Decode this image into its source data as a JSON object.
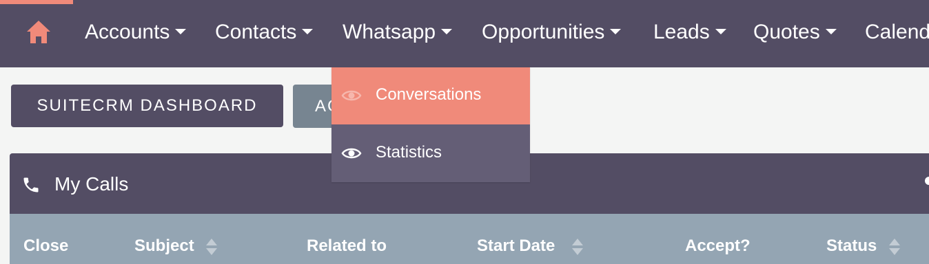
{
  "nav": {
    "items": [
      {
        "label": "Accounts"
      },
      {
        "label": "Contacts"
      },
      {
        "label": "Whatsapp"
      },
      {
        "label": "Opportunities"
      },
      {
        "label": "Leads"
      },
      {
        "label": "Quotes"
      },
      {
        "label": "Calendar"
      }
    ],
    "home_icon": "home-icon",
    "accent_color": "#f08a7a",
    "bar_color": "#534d64"
  },
  "actions": {
    "dashboard_label": "SUITECRM DASHBOARD",
    "actions_label": "ACTIONS"
  },
  "dropdown": {
    "items": [
      {
        "label": "Conversations",
        "icon": "eye-icon",
        "active": true
      },
      {
        "label": "Statistics",
        "icon": "eye-icon",
        "active": false
      }
    ]
  },
  "dashlet": {
    "title": "My Calls",
    "icon": "phone-icon",
    "columns": [
      {
        "label": "Close",
        "sortable": false
      },
      {
        "label": "Subject",
        "sortable": true
      },
      {
        "label": "Related to",
        "sortable": false
      },
      {
        "label": "Start Date",
        "sortable": true
      },
      {
        "label": "Accept?",
        "sortable": false
      },
      {
        "label": "Status",
        "sortable": true
      }
    ]
  }
}
